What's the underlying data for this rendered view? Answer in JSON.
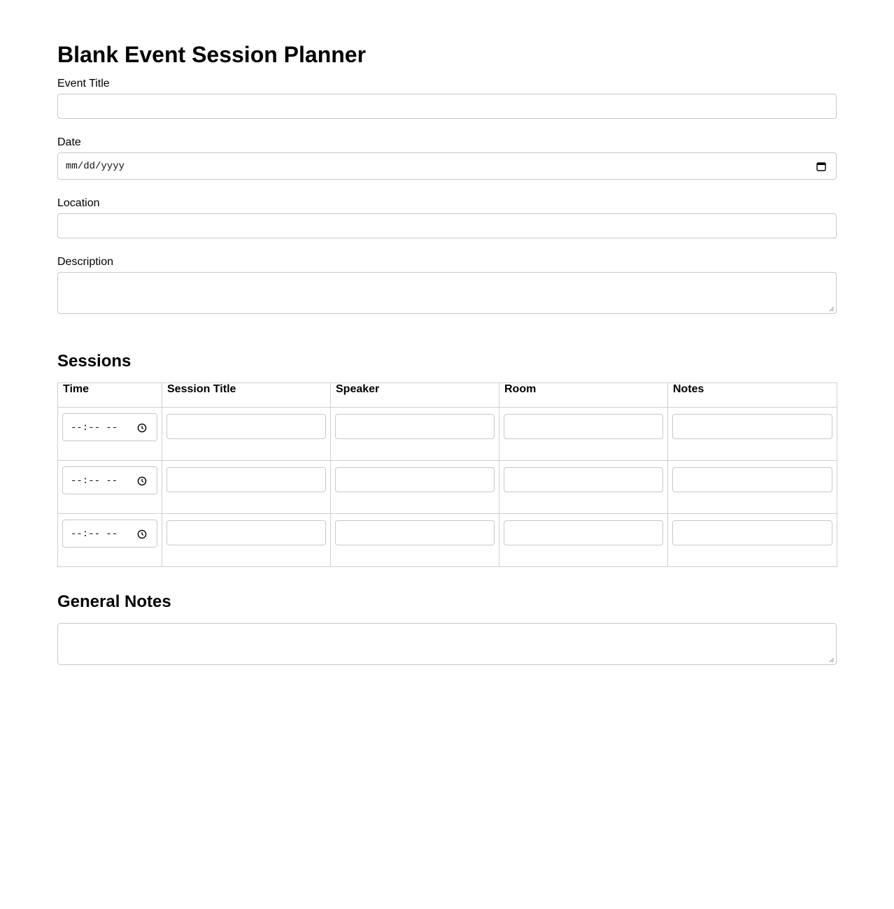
{
  "page": {
    "title": "Blank Event Session Planner"
  },
  "form": {
    "event_title_label": "Event Title",
    "event_title_value": "",
    "date_label": "Date",
    "date_placeholder": "mm/dd/yyyy",
    "location_label": "Location",
    "location_value": "",
    "description_label": "Description",
    "description_value": ""
  },
  "sessions": {
    "heading": "Sessions",
    "columns": [
      "Time",
      "Session Title",
      "Speaker",
      "Room",
      "Notes"
    ],
    "time_placeholder": "--:-- --",
    "rows": [
      {
        "time": "",
        "title": "",
        "speaker": "",
        "room": "",
        "notes": ""
      },
      {
        "time": "",
        "title": "",
        "speaker": "",
        "room": "",
        "notes": ""
      },
      {
        "time": "",
        "title": "",
        "speaker": "",
        "room": "",
        "notes": ""
      }
    ]
  },
  "general_notes": {
    "heading": "General Notes",
    "value": ""
  },
  "icons": {
    "date_picker": "calendar-icon",
    "time_picker": "clock-icon",
    "textarea_resize": "resize-grip-icon"
  }
}
